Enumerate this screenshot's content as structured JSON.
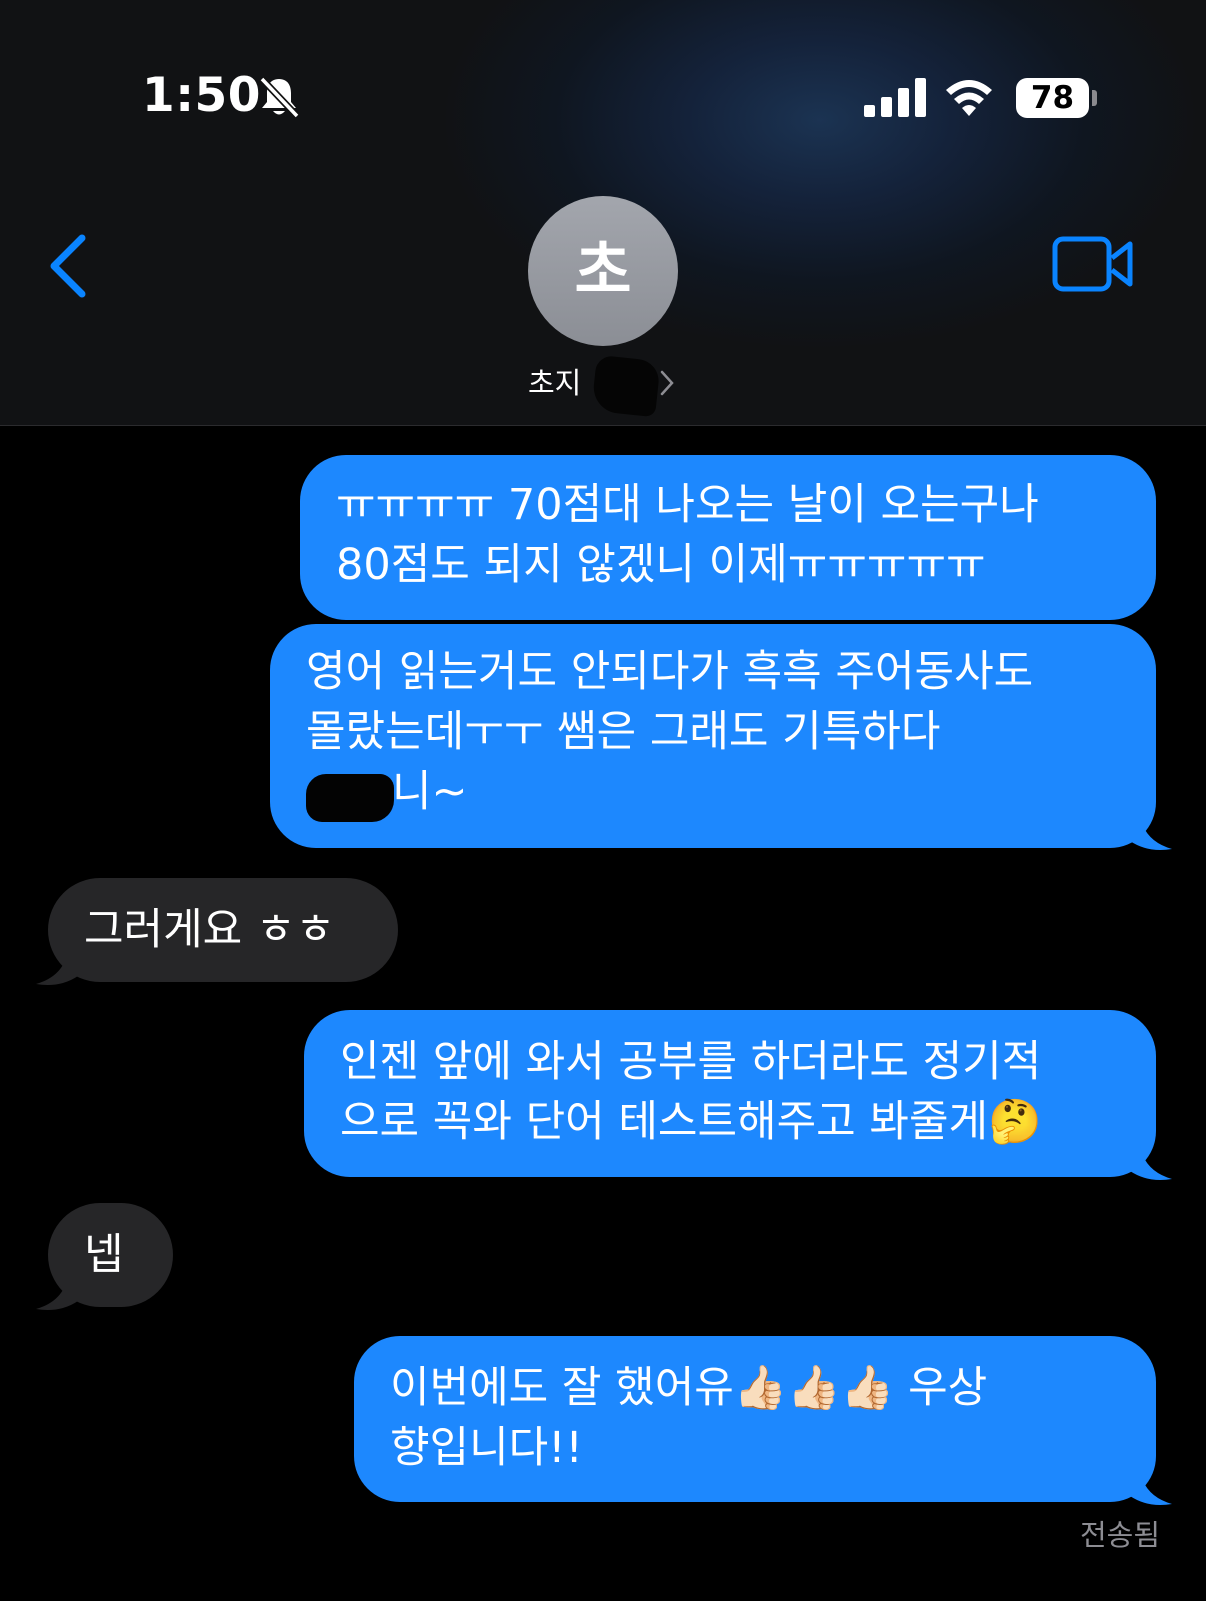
{
  "status_bar": {
    "time": "1:50",
    "mute_icon": "bell-slash-icon",
    "signal_icon": "cellular-signal-icon",
    "wifi_icon": "wifi-icon",
    "battery": "78"
  },
  "header": {
    "back_icon": "chevron-left-icon",
    "video_icon": "video-camera-icon",
    "avatar_initial": "초",
    "contact_name": "초지",
    "chevron_icon": "chevron-right-icon"
  },
  "messages": [
    {
      "direction": "outgoing",
      "lines": [
        "ㅠㅠㅠㅠ 70점대 나오는 날이 오는구나",
        "80점도 되지 않겠니 이제ㅠㅠㅠㅠㅠ"
      ]
    },
    {
      "direction": "outgoing",
      "lines": [
        "영어 읽는거도 안되다가 흑흑 주어동사도",
        "몰랐는데ㅜㅜ 쌤은 그래도 기특하다",
        "니~"
      ]
    },
    {
      "direction": "incoming",
      "lines": [
        "그러게요 ㅎㅎ"
      ]
    },
    {
      "direction": "outgoing",
      "lines": [
        "인젠 앞에 와서 공부를 하더라도 정기적",
        "으로 꼭와 단어 테스트해주고 봐줄게🤔"
      ]
    },
    {
      "direction": "incoming",
      "lines": [
        "넵"
      ]
    },
    {
      "direction": "outgoing",
      "lines": [
        "이번에도 잘 했어유👍🏻👍🏻👍🏻 우상",
        "향입니다!!"
      ]
    }
  ],
  "delivery_status": "전송됨",
  "colors": {
    "outgoing_bubble": "#1d88fe",
    "incoming_bubble": "#262628",
    "accent": "#0a84ff",
    "background": "#000000"
  }
}
